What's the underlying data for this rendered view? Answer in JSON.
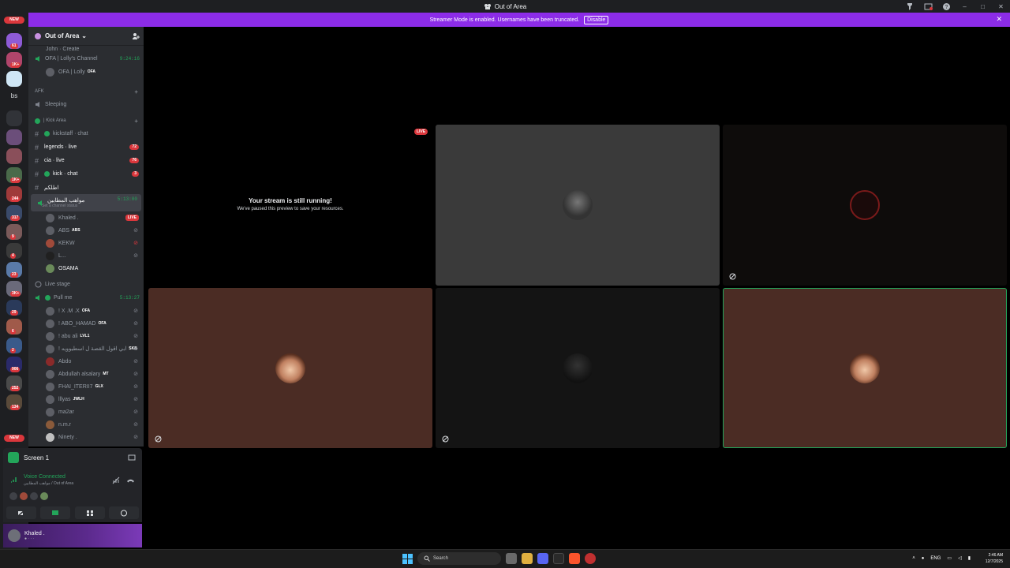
{
  "window": {
    "title": "Out of Area",
    "controls": [
      "–",
      "□",
      "✕"
    ]
  },
  "banner": {
    "text": "Streamer Mode is enabled. Usernames have been truncated.",
    "disable_label": "Disable",
    "close": "✕"
  },
  "rail": {
    "new_top": "NEW",
    "new_bottom": "NEW",
    "bs_label": "bs",
    "badges": [
      "61",
      "1K+",
      "1K+",
      "244",
      "317",
      "9",
      "4",
      "23",
      "3K+",
      "29",
      "6",
      "2",
      "906",
      "252",
      "134"
    ]
  },
  "guild": {
    "name": "Out of Area",
    "chevron": "⌄"
  },
  "channels": {
    "top_clipped": "John · Create",
    "ofa": {
      "name": "OFA | Lolly's Channel",
      "timer": "9:24:16"
    },
    "ofa_user": {
      "name": "OFA | Lolly",
      "tag": "OFA"
    },
    "afk_cat": "AFK",
    "sleeping": "Sleeping",
    "kick_cat": "| Kick Area",
    "kickstaff": "kickstaff · chat",
    "legends": {
      "name": "legends · live",
      "count": "72"
    },
    "cia": {
      "name": "cia · live",
      "count": "76"
    },
    "kick_chat": {
      "name": "kick · chat",
      "count": "3"
    },
    "arabic_text": "اطلكم",
    "active_voice": {
      "name": "مواهب المطابين",
      "timer": "5:13:00",
      "status": "Set a channel status"
    },
    "active_users": [
      {
        "name": "Khaled .",
        "tag": "",
        "live": "LIVE"
      },
      {
        "name": "ABS",
        "tag": "ABS",
        "live": ""
      },
      {
        "name": "KEKW",
        "tag": "",
        "live": ""
      },
      {
        "name": "L...",
        "tag": "",
        "live": ""
      },
      {
        "name": "OSAMA",
        "tag": "",
        "live": ""
      }
    ],
    "live_stage": "Live stage",
    "pull_me": {
      "name": "Pull me",
      "timer": "5:13:27"
    },
    "pull_users": [
      {
        "name": "! X .M .X",
        "tag": "OFA"
      },
      {
        "name": "! ABO_HAMAD",
        "tag": "OFA"
      },
      {
        "name": "! abu ali",
        "tag": "LVL1"
      },
      {
        "name": "! ابي اقول القصة ل اسطيوويه",
        "tag": "SKB"
      },
      {
        "name": "Abdo",
        "tag": ""
      },
      {
        "name": "Abdullah alsalary",
        "tag": "MT"
      },
      {
        "name": "FHAI_ITERII7",
        "tag": "GLX"
      },
      {
        "name": "lllyas",
        "tag": "JWLH"
      },
      {
        "name": "ma2ar",
        "tag": ""
      },
      {
        "name": "n.m.r",
        "tag": ""
      },
      {
        "name": "Ninety .",
        "tag": ""
      }
    ]
  },
  "screen_panel": {
    "label": "Screen 1"
  },
  "voice_panel": {
    "title": "Voice Connected",
    "sub": "مواهب المطابين / Out of Area"
  },
  "user_panel": {
    "name": "Khaled .",
    "sub": "● · · ·"
  },
  "stage": {
    "paused_title": "Your stream is still running!",
    "paused_sub": "We've paused this preview to save your resources.",
    "live_badge": "LIVE"
  },
  "taskbar": {
    "search_placeholder": "Search",
    "lang": "ENG",
    "time": "2:46 AM",
    "date": "12/7/2025"
  },
  "colors": {
    "accent_purple": "#8c2ce8",
    "online_green": "#23a55a",
    "badge_red": "#da373c",
    "tile_brown": "#4b2c24",
    "tile_gray": "#3a3a3a"
  }
}
